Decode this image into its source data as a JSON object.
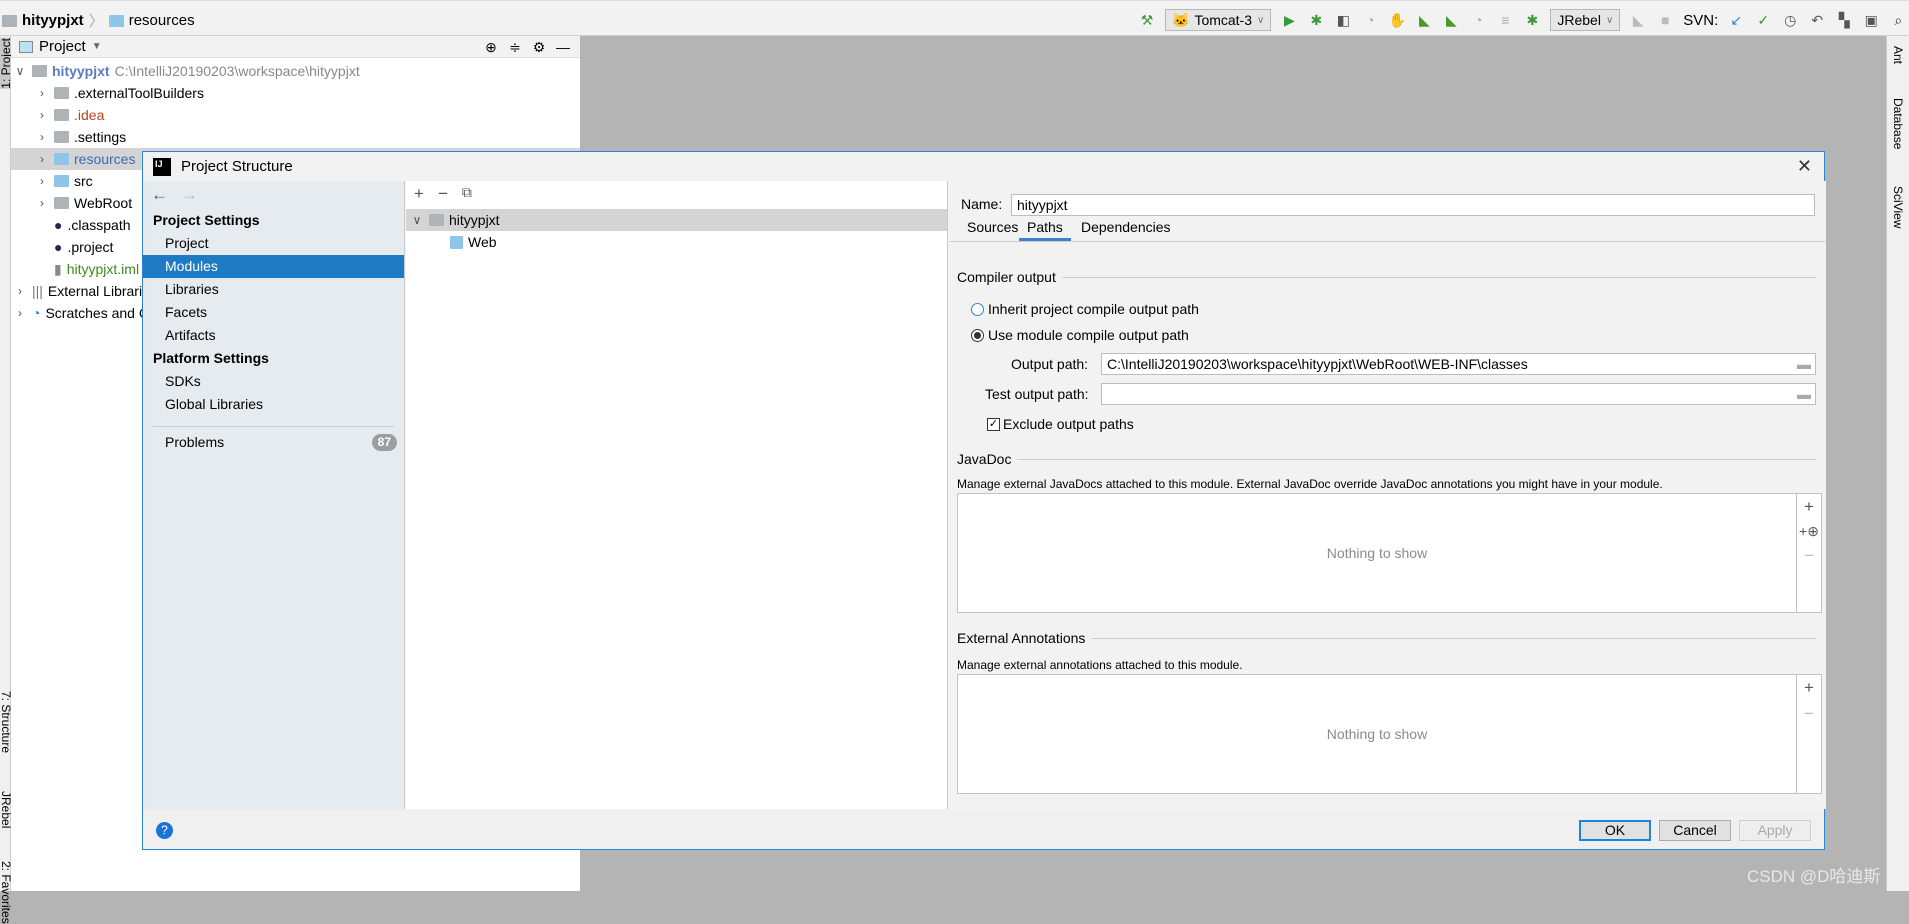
{
  "breadcrumb": {
    "project": "hityypjxt",
    "folder": "resources"
  },
  "toolbar": {
    "run_config": "Tomcat-3",
    "jrebel": "JRebel",
    "svn_label": "SVN:"
  },
  "left_strip": {
    "project": "1: Project",
    "structure": "7: Structure",
    "jrebel": "JRebel",
    "favorites": "2: Favorites"
  },
  "right_strip": {
    "ant": "Ant",
    "database": "Database",
    "sciview": "SciView"
  },
  "project_panel": {
    "title": "Project",
    "root": {
      "name": "hityypjxt",
      "path": "C:\\IntelliJ20190203\\workspace\\hityypjxt"
    },
    "items": [
      {
        "label": ".externalToolBuilders",
        "color": "#000000"
      },
      {
        "label": ".idea",
        "color": "#b8431e"
      },
      {
        "label": ".settings",
        "color": "#000000"
      },
      {
        "label": "resources",
        "color": "#3a6ab0"
      },
      {
        "label": "src",
        "color": "#000000"
      },
      {
        "label": "WebRoot",
        "color": "#000000"
      },
      {
        "label": ".classpath",
        "color": "#000000"
      },
      {
        "label": ".project",
        "color": "#000000"
      },
      {
        "label": "hityypjxt.iml",
        "color": "#3d8a1a"
      }
    ],
    "external": "External Libraries",
    "scratches": "Scratches and Consoles"
  },
  "dialog": {
    "title": "Project Structure",
    "nav": {
      "project_settings": "Project Settings",
      "ps_items": [
        "Project",
        "Modules",
        "Libraries",
        "Facets",
        "Artifacts"
      ],
      "platform_settings": "Platform Settings",
      "pl_items": [
        "SDKs",
        "Global Libraries"
      ],
      "problems": "Problems",
      "problems_count": "87"
    },
    "modules": {
      "root": "hityypjxt",
      "child": "Web"
    },
    "name_label": "Name:",
    "name_value": "hityypjxt",
    "tabs": [
      "Sources",
      "Paths",
      "Dependencies"
    ],
    "active_tab": "Paths",
    "compiler_output": "Compiler output",
    "radio_inherit": "Inherit project compile output path",
    "radio_use": "Use module compile output path",
    "output_label": "Output path:",
    "output_value": "C:\\IntelliJ20190203\\workspace\\hityypjxt\\WebRoot\\WEB-INF\\classes",
    "test_label": "Test output path:",
    "test_value": "",
    "exclude": "Exclude output paths",
    "javadoc": "JavaDoc",
    "javadoc_desc": "Manage external JavaDocs attached to this module. External JavaDoc override JavaDoc annotations you might have in your module.",
    "empty": "Nothing to show",
    "ext_ann": "External Annotations",
    "ext_desc": "Manage external annotations attached to this module.",
    "ok": "OK",
    "cancel": "Cancel",
    "apply": "Apply"
  },
  "watermark": "CSDN @D哈迪斯",
  "colors": {
    "accent": "#1e7ac3",
    "selection": "#d4d4d4"
  }
}
